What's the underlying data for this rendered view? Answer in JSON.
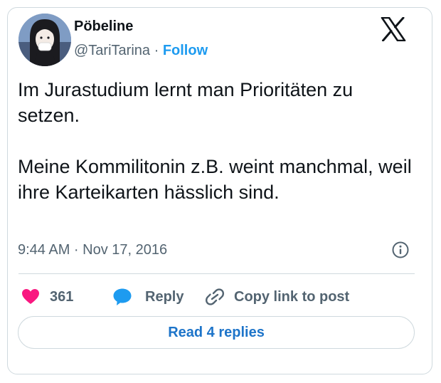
{
  "author": {
    "display_name": "Pöbeline",
    "handle": "@TariTarina",
    "separator": "·",
    "follow_label": "Follow"
  },
  "tweet": {
    "paragraphs": [
      "Im Jurastudium lernt man Prioritäten zu setzen.",
      "Meine Kommilitonin z.B. weint manchmal, weil ihre Karteikarten hässlich sind."
    ],
    "timestamp": "9:44 AM · Nov 17, 2016"
  },
  "actions": {
    "like_count": "361",
    "reply_label": "Reply",
    "copy_link_label": "Copy link to post"
  },
  "footer": {
    "read_replies_label": "Read 4 replies"
  },
  "icons": {
    "logo": "x-logo-icon",
    "info": "info-icon",
    "like": "heart-icon",
    "reply": "speech-bubble-icon",
    "copy": "link-icon"
  },
  "colors": {
    "accent": "#1d9bf0",
    "like": "#f91880",
    "muted": "#536471",
    "text": "#0f1419",
    "border": "#cfd9de"
  }
}
